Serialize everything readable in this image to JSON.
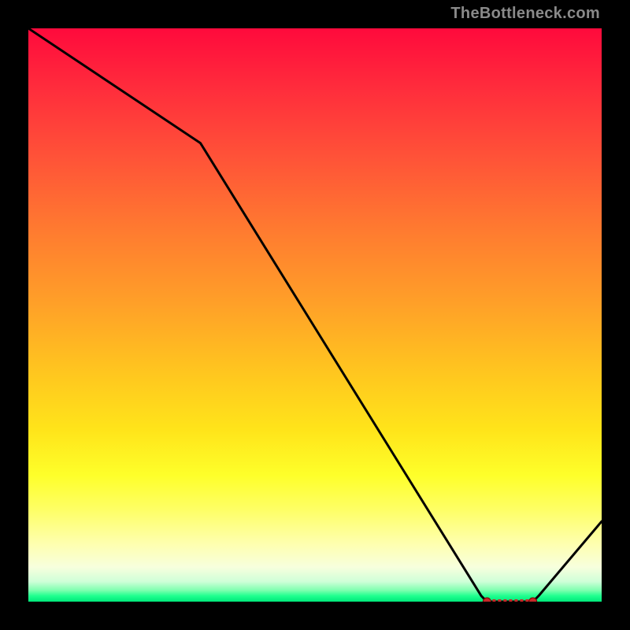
{
  "attribution": "TheBottleneck.com",
  "chart_data": {
    "type": "line",
    "title": "",
    "xlabel": "",
    "ylabel": "",
    "xlim": [
      0,
      100
    ],
    "ylim": [
      0,
      100
    ],
    "x": [
      0,
      30,
      79,
      80,
      88,
      89,
      100
    ],
    "values": [
      100,
      80,
      1,
      0,
      0,
      1,
      14
    ],
    "optimal_band": {
      "x_start": 80,
      "x_end": 88,
      "y": 0
    },
    "colors": {
      "line": "#000000",
      "marker_fill": "#c62828",
      "marker_stroke": "#7a0000"
    }
  }
}
